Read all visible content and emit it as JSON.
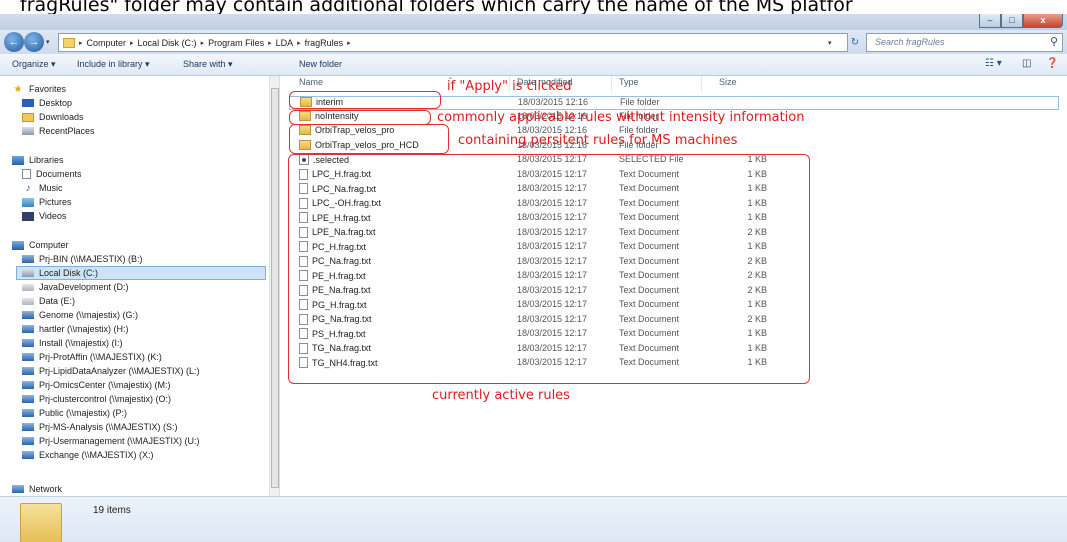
{
  "caption": "fragRules\" folder may contain additional folders which carry the name of the MS platfor",
  "window": {
    "minimize": "–",
    "maximize": "□",
    "close": "x"
  },
  "address": {
    "crumbs": [
      "Computer",
      "Local Disk (C:)",
      "Program Files",
      "LDA",
      "fragRules"
    ],
    "search_placeholder": "Search fragRules"
  },
  "toolbar": {
    "organize": "Organize ▾",
    "include": "Include in library ▾",
    "share": "Share with ▾",
    "new_folder": "New folder"
  },
  "nav": {
    "favorites": "Favorites",
    "fav_items": [
      "Desktop",
      "Downloads",
      "RecentPlaces"
    ],
    "libraries": "Libraries",
    "lib_items": [
      "Documents",
      "Music",
      "Pictures",
      "Videos"
    ],
    "computer": "Computer",
    "drives": [
      "Prj-BIN (\\\\MAJESTIX) (B:)",
      "Local Disk (C:)",
      "JavaDevelopment (D:)",
      "Data (E:)",
      "Genome (\\\\majestix) (G:)",
      "hartler (\\\\majestix) (H:)",
      "Install (\\\\majestix) (I:)",
      "Prj-ProtAffin (\\\\MAJESTIX) (K:)",
      "Prj-LipidDataAnalyzer (\\\\MAJESTIX) (L:)",
      "Prj-OmicsCenter (\\\\majestix) (M:)",
      "Prj-clustercontrol (\\\\majestix) (O:)",
      "Public (\\\\majestix) (P:)",
      "Prj-MS-Analysis (\\\\MAJESTIX) (S:)",
      "Prj-Usermanagement (\\\\MAJESTIX) (U:)",
      "Exchange (\\\\MAJESTIX) (X:)"
    ],
    "network": "Network"
  },
  "columns": {
    "name": "Name",
    "date": "Date modified",
    "type": "Type",
    "size": "Size"
  },
  "files": [
    {
      "name": "interim",
      "date": "18/03/2015 12:16",
      "type": "File folder",
      "size": ""
    },
    {
      "name": "noIntensity",
      "date": "18/03/2015 12:16",
      "type": "File folder",
      "size": ""
    },
    {
      "name": "OrbiTrap_velos_pro",
      "date": "18/03/2015 12:16",
      "type": "File folder",
      "size": ""
    },
    {
      "name": "OrbiTrap_velos_pro_HCD",
      "date": "18/03/2015 12:16",
      "type": "File folder",
      "size": ""
    },
    {
      "name": ".selected",
      "date": "18/03/2015 12:17",
      "type": "SELECTED File",
      "size": "1 KB"
    },
    {
      "name": "LPC_H.frag.txt",
      "date": "18/03/2015 12:17",
      "type": "Text Document",
      "size": "1 KB"
    },
    {
      "name": "LPC_Na.frag.txt",
      "date": "18/03/2015 12:17",
      "type": "Text Document",
      "size": "1 KB"
    },
    {
      "name": "LPC_-OH.frag.txt",
      "date": "18/03/2015 12:17",
      "type": "Text Document",
      "size": "1 KB"
    },
    {
      "name": "LPE_H.frag.txt",
      "date": "18/03/2015 12:17",
      "type": "Text Document",
      "size": "1 KB"
    },
    {
      "name": "LPE_Na.frag.txt",
      "date": "18/03/2015 12:17",
      "type": "Text Document",
      "size": "2 KB"
    },
    {
      "name": "PC_H.frag.txt",
      "date": "18/03/2015 12:17",
      "type": "Text Document",
      "size": "1 KB"
    },
    {
      "name": "PC_Na.frag.txt",
      "date": "18/03/2015 12:17",
      "type": "Text Document",
      "size": "2 KB"
    },
    {
      "name": "PE_H.frag.txt",
      "date": "18/03/2015 12:17",
      "type": "Text Document",
      "size": "2 KB"
    },
    {
      "name": "PE_Na.frag.txt",
      "date": "18/03/2015 12:17",
      "type": "Text Document",
      "size": "2 KB"
    },
    {
      "name": "PG_H.frag.txt",
      "date": "18/03/2015 12:17",
      "type": "Text Document",
      "size": "1 KB"
    },
    {
      "name": "PG_Na.frag.txt",
      "date": "18/03/2015 12:17",
      "type": "Text Document",
      "size": "2 KB"
    },
    {
      "name": "PS_H.frag.txt",
      "date": "18/03/2015 12:17",
      "type": "Text Document",
      "size": "1 KB"
    },
    {
      "name": "TG_Na.frag.txt",
      "date": "18/03/2015 12:17",
      "type": "Text Document",
      "size": "1 KB"
    },
    {
      "name": "TG_NH4.frag.txt",
      "date": "18/03/2015 12:17",
      "type": "Text Document",
      "size": "1 KB"
    }
  ],
  "annotations": {
    "apply": "if \"Apply\" is clicked",
    "common": "commonly applicable rules without intensity information",
    "persistent": "containing persitent rules for MS machines",
    "active": "currently active rules"
  },
  "status": {
    "count": "19 items"
  }
}
